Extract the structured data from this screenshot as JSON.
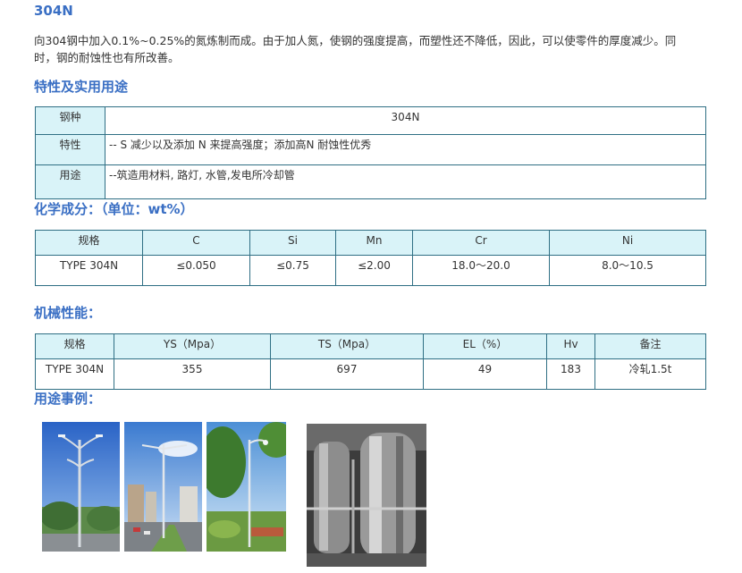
{
  "title": "304N",
  "intro": "向304钢中加入0.1%~0.25%的氮炼制而成。由于加人氮，使钢的强度提高，而塑性还不降低，因此，可以使零件的厚度减少。同时，钢的耐蚀性也有所改善。",
  "section_props": "特性及实用用途",
  "props_table": {
    "row1_label": "钢种",
    "row1_value": "304N",
    "row2_label": "特性",
    "row2_value": "-- S 减少以及添加 N 来提高强度；添加高N 耐蚀性优秀",
    "row3_label": "用途",
    "row3_value": "--筑造用材料, 路灯, 水管,发电所冷却管"
  },
  "section_chem": "化学成分：（单位：wt%）",
  "chem_table": {
    "headers": [
      "规格",
      "C",
      "Si",
      "Mn",
      "Cr",
      "Ni"
    ],
    "row": [
      "TYPE 304N",
      "≤0.050",
      "≤0.75",
      "≤2.00",
      "18.0～20.0",
      "8.0～10.5"
    ]
  },
  "section_mech": "机械性能：",
  "mech_table": {
    "headers": [
      "规格",
      "YS（Mpa）",
      "TS（Mpa）",
      "EL（%）",
      "Hv",
      "备注"
    ],
    "row": [
      "TYPE 304N",
      "355",
      "697",
      "49",
      "183",
      "冷轧1.5t"
    ]
  },
  "section_uses": "用途事例：",
  "images": [
    "street-lamp-photo",
    "street-lamp-photo",
    "street-lamp-photo",
    "stainless-tank-photo"
  ]
}
